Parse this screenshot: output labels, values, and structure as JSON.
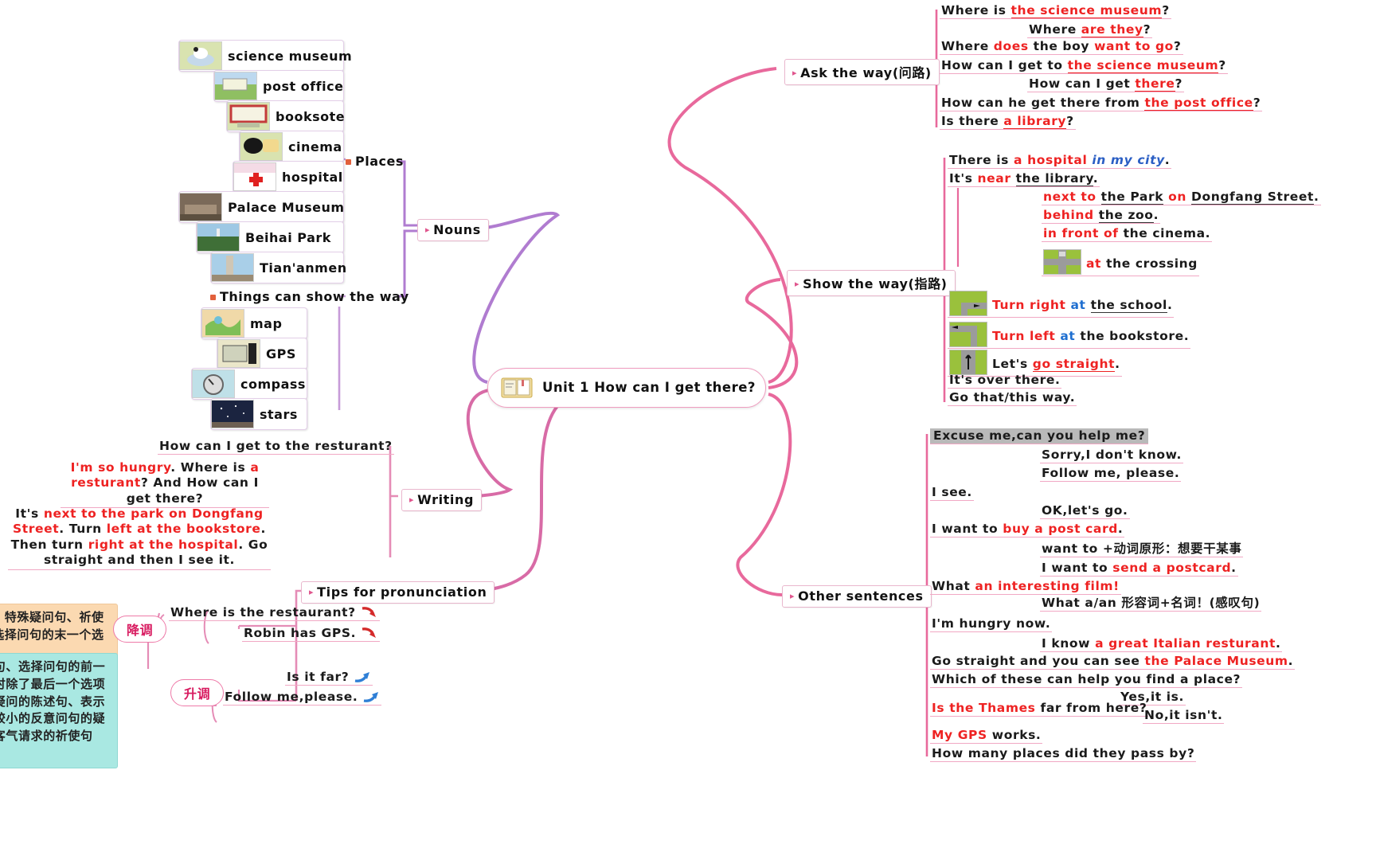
{
  "center": {
    "title": "Unit 1 How can I get there?",
    "icon": "book-icon"
  },
  "branches": {
    "nouns": "Nouns",
    "writing": "Writing",
    "tips": "Tips for pronunciation",
    "ask_the_way": "Ask the way(问路)",
    "show_the_way": "Show the way(指路)",
    "other_sentences": "Other sentences"
  },
  "nouns": {
    "places_label": "Places",
    "places": [
      {
        "label": "science museum",
        "icon": "science-museum-photo"
      },
      {
        "label": "post office",
        "icon": "post-office-photo"
      },
      {
        "label": "booksote",
        "icon": "bookstore-photo"
      },
      {
        "label": "cinema",
        "icon": "cinema-photo"
      },
      {
        "label": "hospital",
        "icon": "hospital-photo"
      },
      {
        "label": "Palace Museum",
        "icon": "palace-museum-photo"
      },
      {
        "label": "Beihai Park",
        "icon": "beihai-park-photo"
      },
      {
        "label": "Tian'anmen",
        "icon": "tiananmen-photo"
      }
    ],
    "things_label": "Things can show the way",
    "things": [
      {
        "label": "map",
        "icon": "map-photo"
      },
      {
        "label": "GPS",
        "icon": "gps-photo"
      },
      {
        "label": "compass",
        "icon": "compass-photo"
      },
      {
        "label": "stars",
        "icon": "stars-photo"
      }
    ]
  },
  "ask_the_way": [
    {
      "id": "a1",
      "parts": [
        {
          "t": "Where is ",
          "s": "plain"
        },
        {
          "t": "the science museum",
          "s": "red-underline"
        },
        {
          "t": "?",
          "s": "plain"
        }
      ]
    },
    {
      "id": "a2",
      "indent": true,
      "parts": [
        {
          "t": "Where ",
          "s": "plain"
        },
        {
          "t": "are they",
          "s": "red-underline"
        },
        {
          "t": "?",
          "s": "plain"
        }
      ]
    },
    {
      "id": "a3",
      "parts": [
        {
          "t": "Where ",
          "s": "plain"
        },
        {
          "t": "does",
          "s": "red"
        },
        {
          "t": " the boy ",
          "s": "plain"
        },
        {
          "t": "want to go",
          "s": "red"
        },
        {
          "t": "?",
          "s": "plain"
        }
      ]
    },
    {
      "id": "a4",
      "parts": [
        {
          "t": "How can I get to ",
          "s": "plain"
        },
        {
          "t": "the science museum",
          "s": "red-underline"
        },
        {
          "t": "?",
          "s": "plain"
        }
      ]
    },
    {
      "id": "a5",
      "indent": true,
      "parts": [
        {
          "t": "How can I get ",
          "s": "plain"
        },
        {
          "t": "there",
          "s": "red-underline"
        },
        {
          "t": "?",
          "s": "plain"
        }
      ]
    },
    {
      "id": "a6",
      "parts": [
        {
          "t": "How can he get there from ",
          "s": "plain"
        },
        {
          "t": "the post office",
          "s": "red-underline"
        },
        {
          "t": "?",
          "s": "plain"
        }
      ]
    },
    {
      "id": "a7",
      "parts": [
        {
          "t": "Is there ",
          "s": "plain"
        },
        {
          "t": "a library",
          "s": "red-underline"
        },
        {
          "t": "?",
          "s": "plain"
        }
      ]
    }
  ],
  "show_the_way": [
    {
      "id": "s1",
      "parts": [
        {
          "t": "There is ",
          "s": "plain"
        },
        {
          "t": "a hospital ",
          "s": "red"
        },
        {
          "t": "in my city",
          "s": "blue-italic"
        },
        {
          "t": ".",
          "s": "plain"
        }
      ]
    },
    {
      "id": "s2",
      "parts": [
        {
          "t": "It's ",
          "s": "plain"
        },
        {
          "t": "near",
          "s": "red"
        },
        {
          "t": " ",
          "s": "plain"
        },
        {
          "t": "the library",
          "s": "underline"
        },
        {
          "t": ".",
          "s": "plain"
        }
      ]
    },
    {
      "id": "s3",
      "indent": true,
      "parts": [
        {
          "t": "next to",
          "s": "red"
        },
        {
          "t": " ",
          "s": "plain"
        },
        {
          "t": "the Park",
          "s": "underline"
        },
        {
          "t": " ",
          "s": "plain"
        },
        {
          "t": "on",
          "s": "red"
        },
        {
          "t": " ",
          "s": "plain"
        },
        {
          "t": "Dongfang Street",
          "s": "underline"
        },
        {
          "t": ".",
          "s": "plain"
        }
      ]
    },
    {
      "id": "s4",
      "indent": true,
      "parts": [
        {
          "t": "behind",
          "s": "red"
        },
        {
          "t": " ",
          "s": "plain"
        },
        {
          "t": "the zoo",
          "s": "underline"
        },
        {
          "t": ".",
          "s": "plain"
        }
      ]
    },
    {
      "id": "s5",
      "indent": true,
      "parts": [
        {
          "t": "in front of",
          "s": "red"
        },
        {
          "t": " the cinema.",
          "s": "plain"
        }
      ]
    },
    {
      "id": "s6",
      "indent": true,
      "icon": "crossing-photo",
      "parts": [
        {
          "t": "at",
          "s": "red"
        },
        {
          "t": " the crossing",
          "s": "plain"
        }
      ]
    },
    {
      "id": "s7",
      "icon": "turn-right-photo",
      "parts": [
        {
          "t": "Turn right",
          "s": "red"
        },
        {
          "t": " ",
          "s": "plain"
        },
        {
          "t": "at",
          "s": "blue"
        },
        {
          "t": " ",
          "s": "plain"
        },
        {
          "t": "the school",
          "s": "underline"
        },
        {
          "t": ".",
          "s": "plain"
        }
      ]
    },
    {
      "id": "s8",
      "icon": "turn-left-photo",
      "parts": [
        {
          "t": "Turn left",
          "s": "red"
        },
        {
          "t": " ",
          "s": "plain"
        },
        {
          "t": "at",
          "s": "blue"
        },
        {
          "t": " the bookstore.",
          "s": "plain"
        }
      ]
    },
    {
      "id": "s9",
      "icon": "go-straight-photo",
      "parts": [
        {
          "t": "Let's ",
          "s": "plain"
        },
        {
          "t": "go straight",
          "s": "red-underline"
        },
        {
          "t": ".",
          "s": "plain"
        }
      ]
    },
    {
      "id": "s10",
      "parts": [
        {
          "t": "It's over there.",
          "s": "plain"
        }
      ]
    },
    {
      "id": "s11",
      "parts": [
        {
          "t": "Go that/this way.",
          "s": "plain"
        }
      ]
    }
  ],
  "other_sentences": [
    {
      "id": "o1",
      "highlight": true,
      "parts": [
        {
          "t": "Excuse me,can you help me?",
          "s": "plain"
        }
      ]
    },
    {
      "id": "o2",
      "indent": true,
      "parts": [
        {
          "t": "Sorry,I don't know.",
          "s": "plain"
        }
      ]
    },
    {
      "id": "o3",
      "indent": true,
      "parts": [
        {
          "t": "Follow me, please.",
          "s": "plain"
        }
      ]
    },
    {
      "id": "o4",
      "parts": [
        {
          "t": "I see.",
          "s": "plain"
        }
      ]
    },
    {
      "id": "o5",
      "indent": true,
      "parts": [
        {
          "t": "OK,let's go.",
          "s": "plain"
        }
      ]
    },
    {
      "id": "o6",
      "parts": [
        {
          "t": "I want to ",
          "s": "plain"
        },
        {
          "t": "buy a post card",
          "s": "red"
        },
        {
          "t": ".",
          "s": "plain"
        }
      ]
    },
    {
      "id": "o7",
      "indent": true,
      "parts": [
        {
          "t": "want to +动词原形：想要干某事",
          "s": "plain"
        }
      ]
    },
    {
      "id": "o8",
      "indent": true,
      "parts": [
        {
          "t": "I want to ",
          "s": "plain"
        },
        {
          "t": "send a postcard",
          "s": "red"
        },
        {
          "t": ".",
          "s": "plain"
        }
      ]
    },
    {
      "id": "o9",
      "parts": [
        {
          "t": "What ",
          "s": "plain"
        },
        {
          "t": "an interesting film",
          "s": "red"
        },
        {
          "t": "!",
          "s": "red"
        }
      ]
    },
    {
      "id": "o10",
      "indent": true,
      "parts": [
        {
          "t": "What a/an 形容词+名词！(感叹句)",
          "s": "plain"
        }
      ]
    },
    {
      "id": "o11",
      "parts": [
        {
          "t": "I'm hungry now.",
          "s": "plain"
        }
      ]
    },
    {
      "id": "o12",
      "indent": true,
      "parts": [
        {
          "t": "I know ",
          "s": "plain"
        },
        {
          "t": "a great Italian resturant",
          "s": "red"
        },
        {
          "t": ".",
          "s": "plain"
        }
      ]
    },
    {
      "id": "o13",
      "parts": [
        {
          "t": "Go straight and you can see ",
          "s": "plain"
        },
        {
          "t": "the Palace Museum",
          "s": "red"
        },
        {
          "t": ".",
          "s": "plain"
        }
      ]
    },
    {
      "id": "o14",
      "parts": [
        {
          "t": "Which of these can help you find a place?",
          "s": "plain"
        }
      ]
    },
    {
      "id": "o15",
      "indent": true,
      "parts": [
        {
          "t": "Yes,it is.",
          "s": "plain"
        }
      ]
    },
    {
      "id": "o16",
      "parts": [
        {
          "t": "Is ",
          "s": "red"
        },
        {
          "t": "the Thames",
          "s": "red"
        },
        {
          "t": " far from here?",
          "s": "plain"
        }
      ]
    },
    {
      "id": "o17",
      "indent": true,
      "parts": [
        {
          "t": "No,it isn't.",
          "s": "plain"
        }
      ]
    },
    {
      "id": "o18",
      "parts": [
        {
          "t": "My GPS",
          "s": "red"
        },
        {
          "t": " works.",
          "s": "plain"
        }
      ]
    },
    {
      "id": "o19",
      "parts": [
        {
          "t": "How many places did they pass by?",
          "s": "plain"
        }
      ]
    }
  ],
  "writing": {
    "q": "How can I get to the resturant?",
    "a1_parts": [
      {
        "t": "I'm so hungry",
        "s": "red"
      },
      {
        "t": ". Where is ",
        "s": "plain"
      },
      {
        "t": "a resturant",
        "s": "red"
      },
      {
        "t": "? And How can I get there?",
        "s": "plain"
      }
    ],
    "a2_parts": [
      {
        "t": "It's ",
        "s": "plain"
      },
      {
        "t": "next to the park on Dongfang Street",
        "s": "red"
      },
      {
        "t": ". Turn ",
        "s": "plain"
      },
      {
        "t": "left at the bookstore",
        "s": "red"
      },
      {
        "t": ". Then turn ",
        "s": "plain"
      },
      {
        "t": "right at the hospital",
        "s": "red"
      },
      {
        "t": ". Go straight and then I see it.",
        "s": "plain"
      }
    ]
  },
  "pronunciation": {
    "falling_label": "降调",
    "rising_label": "升调",
    "falling_note": "一般用于陈述句、特殊疑问句、祈使句、感叹句以及选择问句的末一个选项。",
    "rising_note": "一般用于一般疑问句、选择问句的前一个选项、列举事物时除了最后一个选项的前面各项、表示疑问的陈述句、表示说话人对情况把握较小的反意问句的疑问部分，以及表示客气请求的祈使句等。",
    "falling_items": [
      {
        "text": "Where is the restaurant?",
        "arrow": "arrow-down-red-icon"
      },
      {
        "text": "Robin has GPS.",
        "arrow": "arrow-down-red-icon"
      }
    ],
    "rising_items": [
      {
        "text": "Is it far?",
        "arrow": "arrow-up-blue-icon"
      },
      {
        "text": "Follow me,please.",
        "arrow": "arrow-up-blue-icon"
      }
    ]
  },
  "colors": {
    "link_pink": "#e8699c",
    "link_purple": "#b07cd0",
    "accent_red": "#ee2222",
    "accent_blue": "#2a5ec4",
    "capsule_border": "#e9b7cd"
  }
}
